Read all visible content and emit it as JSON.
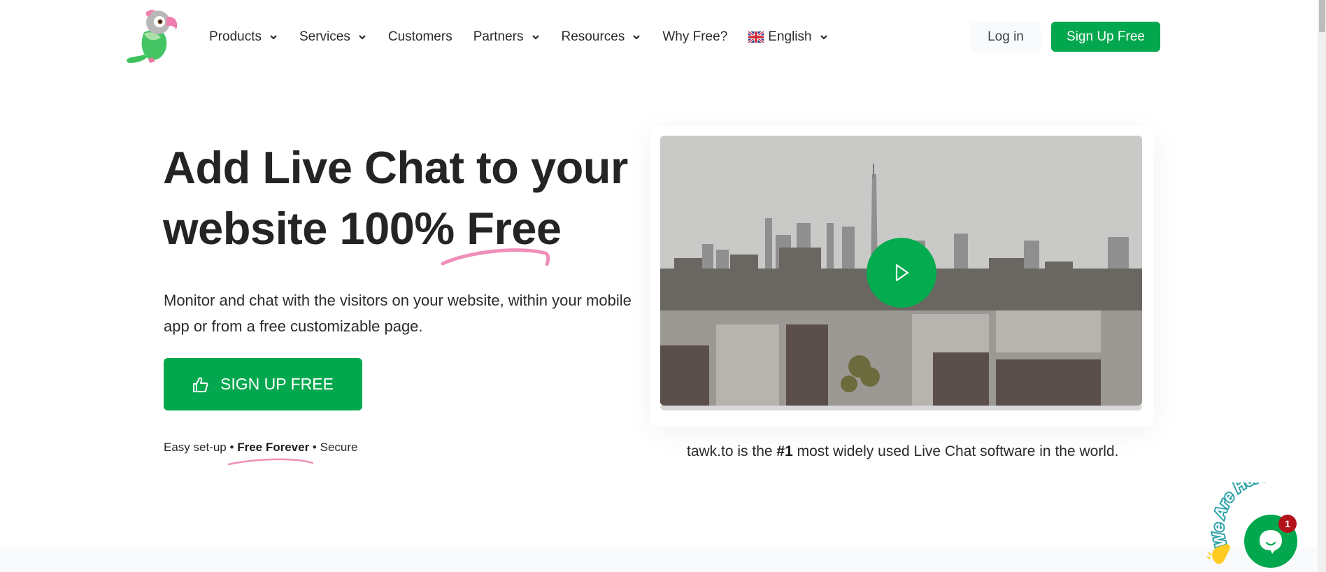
{
  "header": {
    "logo_alt": "tawk.to parrot logo",
    "nav": [
      {
        "label": "Products",
        "has_dropdown": true
      },
      {
        "label": "Services",
        "has_dropdown": true
      },
      {
        "label": "Customers",
        "has_dropdown": false
      },
      {
        "label": "Partners",
        "has_dropdown": true
      },
      {
        "label": "Resources",
        "has_dropdown": true
      },
      {
        "label": "Why Free?",
        "has_dropdown": false
      }
    ],
    "language": {
      "label": "English",
      "flag": "uk-flag-icon"
    },
    "login_label": "Log in",
    "signup_label": "Sign Up Free"
  },
  "hero": {
    "title_line1": "Add Live Chat to your",
    "title_line2": "website 100% Free",
    "description": "Monitor and chat with the visitors on your website, within your mobile app or from a free customizable page.",
    "cta_label": "SIGN UP FREE",
    "cta_icon": "thumbs-up-icon",
    "features": {
      "item1": "Easy set-up",
      "separator": "•",
      "item2": "Free Forever",
      "item3": "Secure"
    }
  },
  "video": {
    "thumbnail": "city-skyline-image",
    "play_icon": "play-icon",
    "tagline_prefix": "tawk.to is the",
    "tagline_bold": "#1",
    "tagline_suffix": "most widely used Live Chat software in the world."
  },
  "chat_widget": {
    "banner_text": "We Are Here!",
    "badge_count": "1"
  },
  "colors": {
    "brand_green": "#03a84e",
    "accent_pink": "#ef8fb8",
    "text_dark": "#242424",
    "badge_red": "#b3121b"
  }
}
